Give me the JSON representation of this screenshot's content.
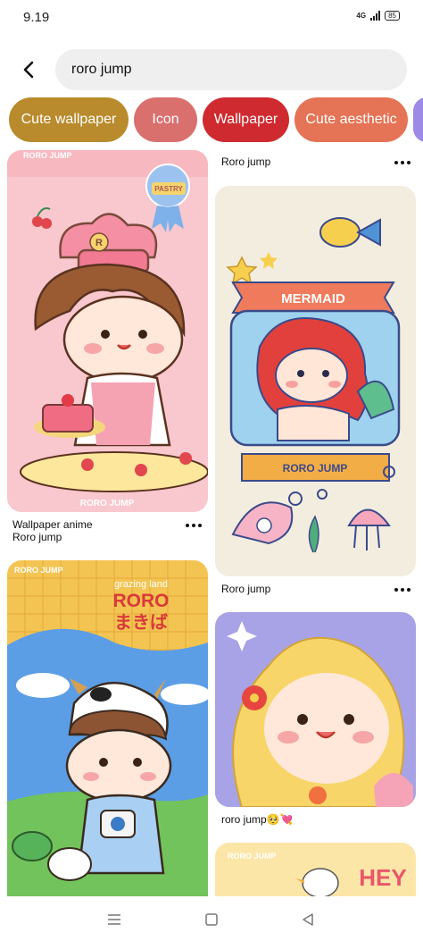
{
  "status_bar": {
    "time": "9.19",
    "network": "4G",
    "battery": "85"
  },
  "search": {
    "query": "roro jump",
    "icons": {
      "back": "chevron-left-icon"
    }
  },
  "chips": [
    {
      "label": "Cute wallpaper",
      "color": "#b98b2c"
    },
    {
      "label": "Icon",
      "color": "#d9706e"
    },
    {
      "label": "Wallpaper",
      "color": "#cf2a2f"
    },
    {
      "label": "Cute aesthetic",
      "color": "#e57355"
    },
    {
      "label": "",
      "color": "#9d89e6"
    }
  ],
  "pins": {
    "left": [
      {
        "title_line1": "Wallpaper anime",
        "title_line2": "Roro jump",
        "image_text": "RORO JUMP",
        "badge_text": "PASTRY"
      },
      {
        "image_text": "RORO JUMP",
        "sub_text": "grazing land",
        "big_text": "RORO",
        "jp_text": "まきば"
      }
    ],
    "right": [
      {
        "title": "Roro jump"
      },
      {
        "title": "Roro jump",
        "banner_text": "MERMAID",
        "ribbon_text": "RORO JUMP"
      },
      {
        "title": "roro jump🥺💘"
      },
      {
        "image_text": "RORO JUMP",
        "hey_text": "HEY"
      }
    ]
  },
  "nav": {
    "icons": [
      "menu-icon",
      "home-square-icon",
      "back-triangle-icon"
    ]
  }
}
